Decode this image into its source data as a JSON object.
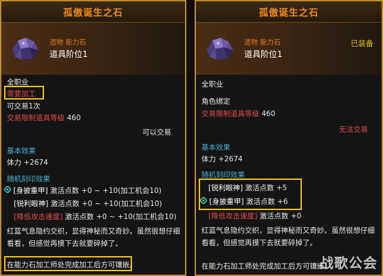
{
  "left": {
    "title": "孤傲诞生之石",
    "grade_label": "遗物 能力石",
    "rank": "道具阶位1",
    "class_req": "全职业",
    "needs_process": "需要加工",
    "tradable_times": "可交易1次",
    "restricted_level_label": "交易限制道具等级",
    "restricted_level_value": "460",
    "trade_status": "可以交易",
    "basic_effect_title": "基本效果",
    "stat_name": "体力",
    "stat_value": "+2674",
    "random_title": "随机刻印效果",
    "engravings": [
      {
        "tag": "[身披重甲]",
        "text": "激活点数 +0 ~ +10(加工机会10)",
        "pinned": true,
        "negative": false
      },
      {
        "tag": "[锐利眼神]",
        "text": "激活点数 +0 ~ +10(加工机会10)",
        "pinned": false,
        "negative": false
      },
      {
        "tag": "[降低攻击速度]",
        "text": "激活点数 +0 ~ +10(加工机会10)",
        "pinned": false,
        "negative": true
      }
    ],
    "flavor_line1": "红蓝气息隐约交织，显得神秘而又奇妙。虽然很想仔细",
    "flavor_line2": "看看，但感觉再摸下去就要碎掉了。",
    "footer": "在能力石加工师处完成加工后方可镶嵌。"
  },
  "right": {
    "title": "孤傲诞生之石",
    "grade_label": "遗物 能力石",
    "rank": "道具阶位1",
    "equipped": "已装备",
    "class_req": "全职业",
    "bound": "角色绑定",
    "restricted_level_label": "交易限制道具等级",
    "restricted_level_value": "460",
    "trade_status": "无法交易",
    "basic_effect_title": "基本效果",
    "stat_name": "体力",
    "stat_value": "+2674",
    "random_title": "随机刻印效果",
    "engravings": [
      {
        "tag": "[锐利眼神]",
        "text": "激活点数 +5",
        "pinned": false,
        "negative": false
      },
      {
        "tag": "[身披重甲]",
        "text": "激活点数 +6",
        "pinned": true,
        "negative": false
      },
      {
        "tag": "[降低攻击速度]",
        "text": "激活点数 +0",
        "pinned": false,
        "negative": true
      }
    ],
    "flavor_line1": "红蓝气息隐约交织，显得神秘而又奇妙。虽然很想仔细",
    "flavor_line2": "看看，但感觉再摸下去就要碎掉了。",
    "footer": "在能力石加工师处完成加工后方可镶嵌。"
  },
  "watermark": "战歌公会",
  "colors": {
    "border": "#c08a2a",
    "title": "#f28a1c",
    "highlight": "#f0c01a",
    "negative": "#e44d4d",
    "cyan": "#4ab0d8"
  }
}
